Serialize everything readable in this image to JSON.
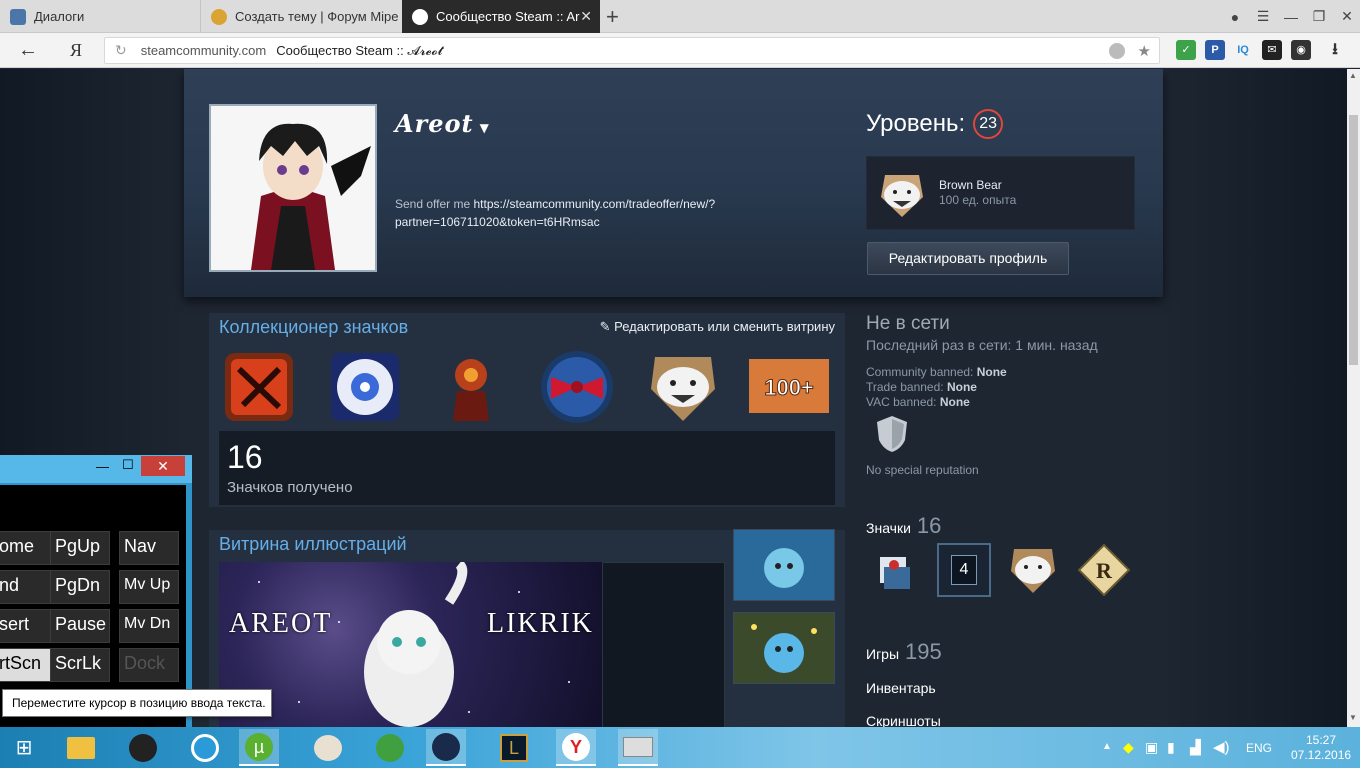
{
  "browser": {
    "tabs": [
      {
        "title": "Диалоги"
      },
      {
        "title": "Создать тему | Форум Mipe"
      },
      {
        "title": "Сообщество Steam :: Ar"
      }
    ],
    "new_tab": "+",
    "back": "←",
    "yandex": "Я",
    "address": {
      "domain": "steamcommunity.com",
      "title": "Сообщество Steam :: 𝓐𝓻𝓮𝓸𝓽"
    }
  },
  "profile": {
    "name": "Areot",
    "summary_prefix": "Send offer me ",
    "summary_link": "https://steamcommunity.com/tradeoffer/new/?partner=106711020&token=t6HRmsac",
    "level_label": "Уровень:",
    "level": "23",
    "favorite_badge": {
      "name": "Brown Bear",
      "xp": "100 ед. опыта"
    },
    "edit_button": "Редактировать профиль"
  },
  "badge_showcase": {
    "title": "Коллекционер значков",
    "edit": "Редактировать или сменить витрину",
    "count": "16",
    "count_label": "Значков получено"
  },
  "art_showcase": {
    "title": "Витрина иллюстраций",
    "text_left": "AREOT",
    "text_right": "LIKRIK"
  },
  "side": {
    "status": "Не в сети",
    "last_online": "Последний раз в сети: 1 мин. назад",
    "bans": [
      {
        "label": "Community banned: ",
        "value": "None"
      },
      {
        "label": "Trade banned: ",
        "value": "None"
      },
      {
        "label": "VAC banned: ",
        "value": "None"
      }
    ],
    "reputation": "No special reputation",
    "badges_label": "Значки",
    "badges_count": "16",
    "badge_level_4": "4",
    "games_label": "Игры",
    "games_count": "195",
    "inventory": "Инвентарь",
    "screenshots": "Скриншоты"
  },
  "osk": {
    "keys": [
      [
        "ome",
        "PgUp",
        "Nav"
      ],
      [
        "nd",
        "PgDn",
        "Mv Up"
      ],
      [
        "sert",
        "Pause",
        "Mv Dn"
      ],
      [
        "rtScn",
        "ScrLk",
        "Dock"
      ]
    ],
    "tooltip": "Переместите курсор в позицию ввода текста."
  },
  "taskbar": {
    "lang": "ENG",
    "time": "15:27",
    "date": "07.12.2016"
  },
  "colors": {
    "steam_bg": "#1b2838",
    "link_blue": "#66aee8",
    "level_ring": "#e0463a"
  }
}
